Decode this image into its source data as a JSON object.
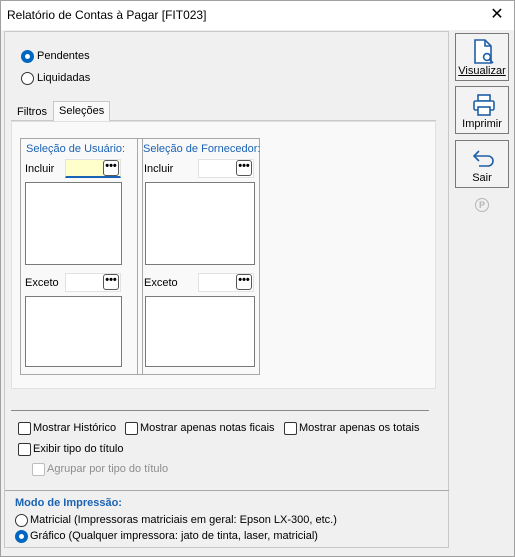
{
  "window": {
    "title": "Relatório de Contas à Pagar [FIT023]"
  },
  "status_filter": {
    "options": [
      {
        "label": "Pendentes",
        "selected": true
      },
      {
        "label": "Liquidadas",
        "selected": false
      }
    ]
  },
  "tabs": [
    {
      "label": "Filtros",
      "active": false
    },
    {
      "label": "Seleções",
      "active": true
    }
  ],
  "selecoes": {
    "usuario": {
      "title": "Seleção de Usuário:",
      "include_label": "Incluir",
      "exclude_label": "Exceto",
      "button_glyph": "•••"
    },
    "fornecedor": {
      "title": "Seleção de Fornecedor:",
      "include_label": "Incluir",
      "exclude_label": "Exceto",
      "button_glyph": "•••"
    }
  },
  "options": {
    "mostrar_historico": "Mostrar Histórico",
    "mostrar_notas": "Mostrar apenas notas ficais",
    "mostrar_totais": "Mostrar apenas os totais",
    "exibir_tipo": "Exibir tipo do título",
    "agrupar_tipo": "Agrupar por tipo do título"
  },
  "print_mode": {
    "title": "Modo de Impressão:",
    "options": [
      {
        "label": "Matricial (Impressoras matriciais em geral: Epson LX-300, etc.)",
        "selected": false
      },
      {
        "label": "Gráfico (Qualquer impressora: jato de tinta, laser, matricial)",
        "selected": true
      }
    ]
  },
  "toolbar": {
    "visualizar": "Visualizar",
    "imprimir": "Imprimir",
    "sair": "Sair",
    "p_glyph": "P"
  },
  "colors": {
    "accent": "#0067c0",
    "group_title": "#1a62b3",
    "highlight": "#ffffcc"
  },
  "icons": [
    "close-icon",
    "preview-document-icon",
    "printer-icon",
    "return-arrow-icon",
    "p-circle-icon"
  ]
}
